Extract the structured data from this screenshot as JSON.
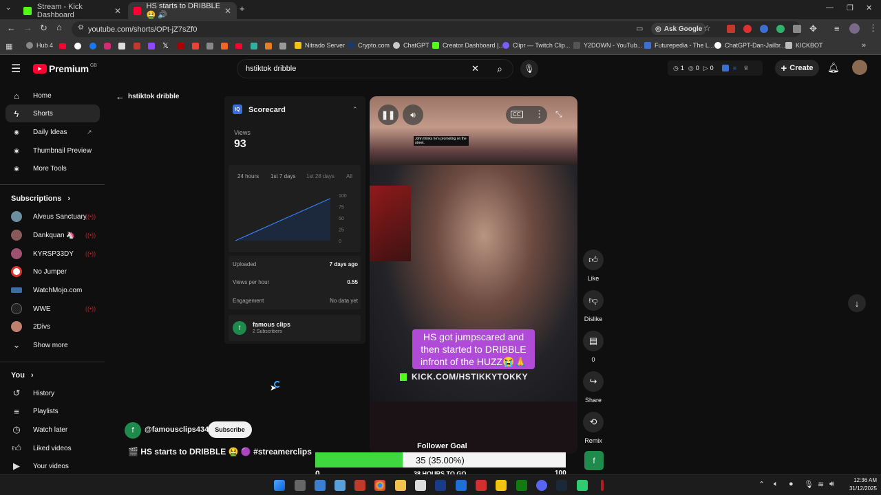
{
  "browser": {
    "tabs": [
      {
        "title": "Stream - Kick Dashboard",
        "color": "#53fc18"
      },
      {
        "title": "HS starts to DRIBBLE 🤮 🔊",
        "color": "#ff0033"
      }
    ],
    "new_tab": "+",
    "url": "youtube.com/shorts/OPt-jZ7sZf0",
    "ask_google": "Ask Google",
    "bookmarks": [
      "Hub 4",
      "Nitrado Server",
      "Crypto.com",
      "ChatGPT",
      "Creator Dashboard |...",
      "Clipr — Twitch Clip...",
      "Y2DOWN - YouTub...",
      "Futurepedia - The L...",
      "ChatGPT-Dan-Jailbr...",
      "KICKBOT"
    ]
  },
  "yt": {
    "logo": "Premium",
    "logo_region": "GB",
    "search_value": "hstiktok dribble",
    "counters": {
      "a": "1",
      "b": "0",
      "c": "0"
    },
    "create": "Create"
  },
  "sidebar": {
    "main": [
      {
        "label": "Home",
        "icon": "home-icon"
      },
      {
        "label": "Shorts",
        "icon": "shorts-icon"
      },
      {
        "label": "Daily Ideas",
        "icon": "ideas-icon"
      },
      {
        "label": "Thumbnail Preview",
        "icon": "thumbnail-icon"
      },
      {
        "label": "More Tools",
        "icon": "tools-icon"
      }
    ],
    "subs_title": "Subscriptions",
    "subs": [
      {
        "name": "Alveus Sanctuary",
        "color": "#6b8fa0",
        "live": true
      },
      {
        "name": "Dankquan 🦄",
        "color": "#8a5a5a",
        "live": true
      },
      {
        "name": "KYRSP33DY",
        "color": "#a05070",
        "live": true
      },
      {
        "name": "No Jumper",
        "color": "#ffffff",
        "live": false
      },
      {
        "name": "WatchMojo.com",
        "color": "#3a6ea8",
        "live": false
      },
      {
        "name": "WWE",
        "color": "#222222",
        "live": true
      },
      {
        "name": "2Divs",
        "color": "#c08070",
        "live": false
      }
    ],
    "show_more": "Show more",
    "you_title": "You",
    "you": [
      {
        "label": "History",
        "icon": "history-icon"
      },
      {
        "label": "Playlists",
        "icon": "playlists-icon"
      },
      {
        "label": "Watch later",
        "icon": "watch-later-icon"
      },
      {
        "label": "Liked videos",
        "icon": "liked-icon"
      },
      {
        "label": "Your videos",
        "icon": "your-videos-icon"
      }
    ]
  },
  "page": {
    "back_title": "hstiktok dribble"
  },
  "scorecard": {
    "title": "Scorecard",
    "views_label": "Views",
    "views": "93",
    "ranges": [
      "24 hours",
      "1st 7 days",
      "1st 28 days",
      "All"
    ],
    "y_ticks": [
      "100",
      "75",
      "50",
      "25",
      "0"
    ],
    "uploaded_label": "Uploaded",
    "uploaded": "7 days ago",
    "vph_label": "Views per hour",
    "vph": "0.55",
    "eng_label": "Engagement",
    "eng": "No data yet",
    "channel": "famous clips",
    "channel_subs": "2 Subscribers"
  },
  "chart_data": {
    "type": "line",
    "x": [
      0,
      1
    ],
    "values": [
      0,
      93
    ],
    "ylim": [
      0,
      100
    ],
    "y_ticks": [
      0,
      25,
      50,
      75,
      100
    ],
    "grid": false
  },
  "video": {
    "top_caption": "John thinks he's promoting on the street.",
    "caption": "HS got jumpscared and then started to DRIBBLE infront of the HUZZ😭🙏",
    "kick_url": "KICK.COM/HSTIKKYTOKKY",
    "handle": "@famousclips434",
    "subscribe": "Subscribe",
    "title": "🎬 HS starts to DRIBBLE 🤮 🟣 #streamerclips"
  },
  "actions": {
    "like": "Like",
    "dislike": "Dislike",
    "comments": "0",
    "share": "Share",
    "remix": "Remix",
    "channel_initial": "f"
  },
  "overlay": {
    "title": "Follower Goal",
    "value": "35 (35.00%)",
    "progress": 0.35,
    "min": "0",
    "max": "100",
    "remaining": "38 HOURS TO GO"
  },
  "taskbar": {
    "time": "12:36 AM",
    "date": "31/12/2025"
  }
}
